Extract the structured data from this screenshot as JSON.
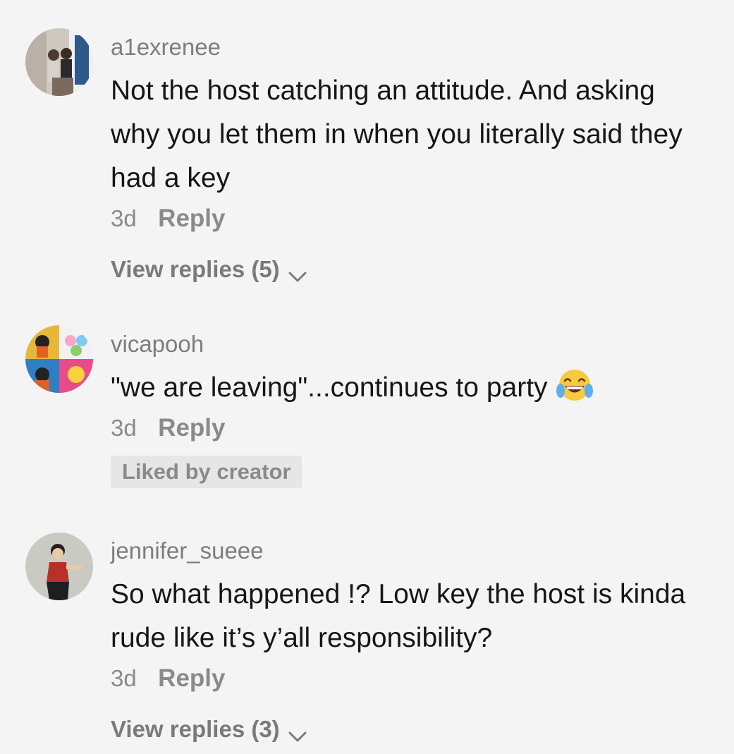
{
  "comments": [
    {
      "username": "a1exrenee",
      "text": "Not the host catching an attitude. And asking why you let them in when you literally said they had a key",
      "time": "3d",
      "reply_label": "Reply",
      "view_replies": "View replies (5)"
    },
    {
      "username": "vicapooh",
      "text": "\"we are leaving\"...continues to party",
      "emoji": "face-with-tears-of-joy",
      "time": "3d",
      "reply_label": "Reply",
      "badge": "Liked by creator"
    },
    {
      "username": "jennifer_sueee",
      "text": "So what happened !? Low key the host is kinda rude like it’s y’all responsibility?",
      "time": "3d",
      "reply_label": "Reply",
      "view_replies": "View replies (3)"
    }
  ]
}
